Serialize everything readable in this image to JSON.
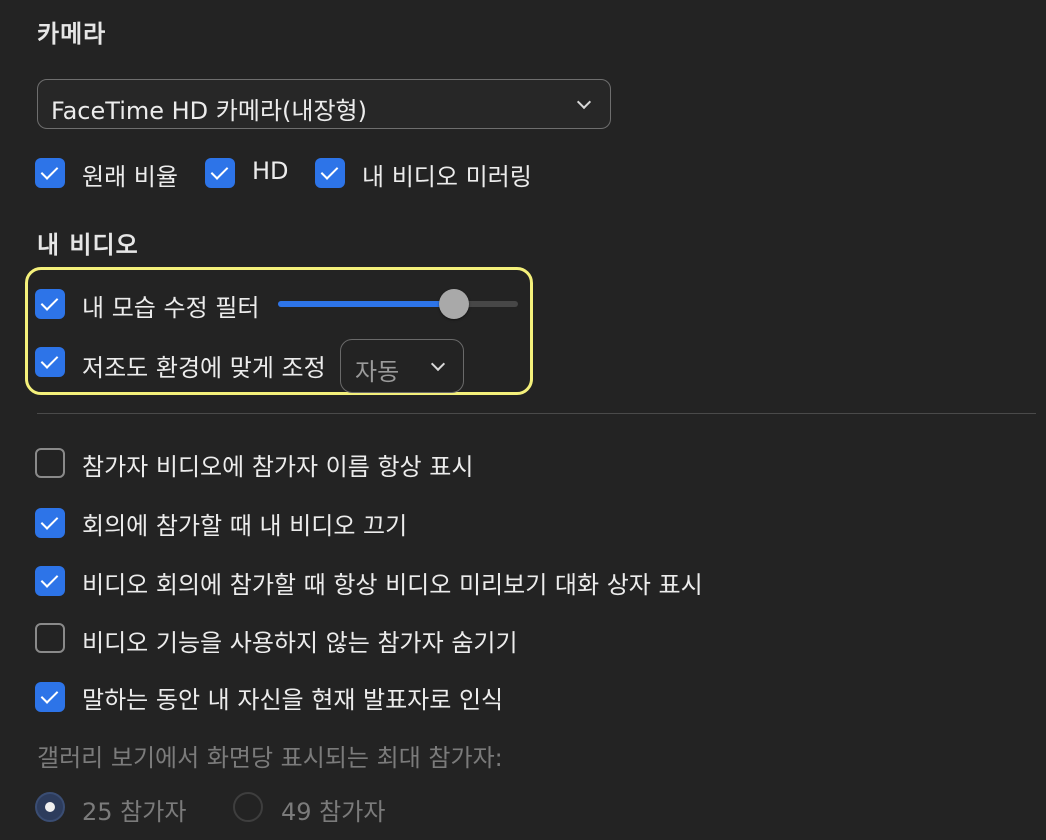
{
  "camera": {
    "section_title": "카메라",
    "device_select": {
      "value": "FaceTime HD 카메라(내장형)"
    },
    "options": [
      {
        "label": "원래 비율",
        "checked": true
      },
      {
        "label": "HD",
        "checked": true
      },
      {
        "label": "내 비디오 미러링",
        "checked": true
      }
    ]
  },
  "my_video": {
    "section_title": "내 비디오",
    "touch_up": {
      "label": "내 모습 수정 필터",
      "checked": true,
      "slider_level": 0.73
    },
    "low_light": {
      "label": "저조도 환경에 맞게 조정",
      "checked": true,
      "mode_select": {
        "value": "자동"
      }
    }
  },
  "general": [
    {
      "label": "참가자 비디오에 참가자 이름 항상 표시",
      "checked": false
    },
    {
      "label": "회의에 참가할 때 내 비디오 끄기",
      "checked": true
    },
    {
      "label": "비디오 회의에 참가할 때 항상 비디오 미리보기 대화 상자 표시",
      "checked": true
    },
    {
      "label": "비디오 기능을 사용하지 않는 참가자 숨기기",
      "checked": false
    },
    {
      "label": "말하는 동안 내 자신을 현재 발표자로 인식",
      "checked": true
    }
  ],
  "gallery": {
    "title": "갤러리 보기에서 화면당 표시되는 최대 참가자:",
    "options": [
      {
        "label": "25 참가자",
        "selected": true
      },
      {
        "label": "49 참가자",
        "selected": false
      }
    ]
  },
  "colors": {
    "background": "#232323",
    "accent": "#2d74e8",
    "highlight_border": "#f4f07b"
  },
  "icons": {
    "dropdown_chevron": "chevron-down-icon",
    "checkmark": "checkmark-icon"
  }
}
